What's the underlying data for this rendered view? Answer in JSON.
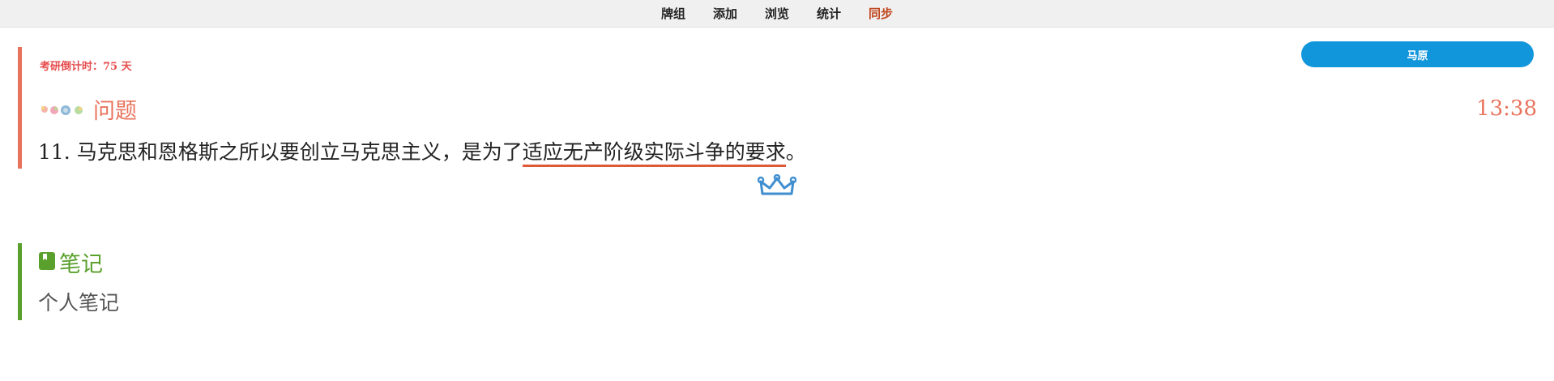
{
  "nav": {
    "items": [
      {
        "label": "牌组"
      },
      {
        "label": "添加"
      },
      {
        "label": "浏览"
      },
      {
        "label": "统计"
      },
      {
        "label": "同步"
      }
    ]
  },
  "deck_button": {
    "label": "马原"
  },
  "question": {
    "countdown": "考研倒计时：75 天",
    "title": "问题",
    "timer": "13:38",
    "text_before": "11. 马克思和恩格斯之所以要创立马克思主义，是为了",
    "answer": "适应无产阶级实际斗争的要求",
    "text_after": "。"
  },
  "note": {
    "title": "笔记",
    "text": "个人笔记"
  },
  "colors": {
    "accent_red": "#e8735c",
    "countdown_red": "#e64d4d",
    "accent_green": "#5aa02c",
    "button_blue": "#1296db",
    "active_nav": "#c0471f"
  },
  "icons": [
    "flower-decoration-icon",
    "crown-icon",
    "book-icon"
  ]
}
